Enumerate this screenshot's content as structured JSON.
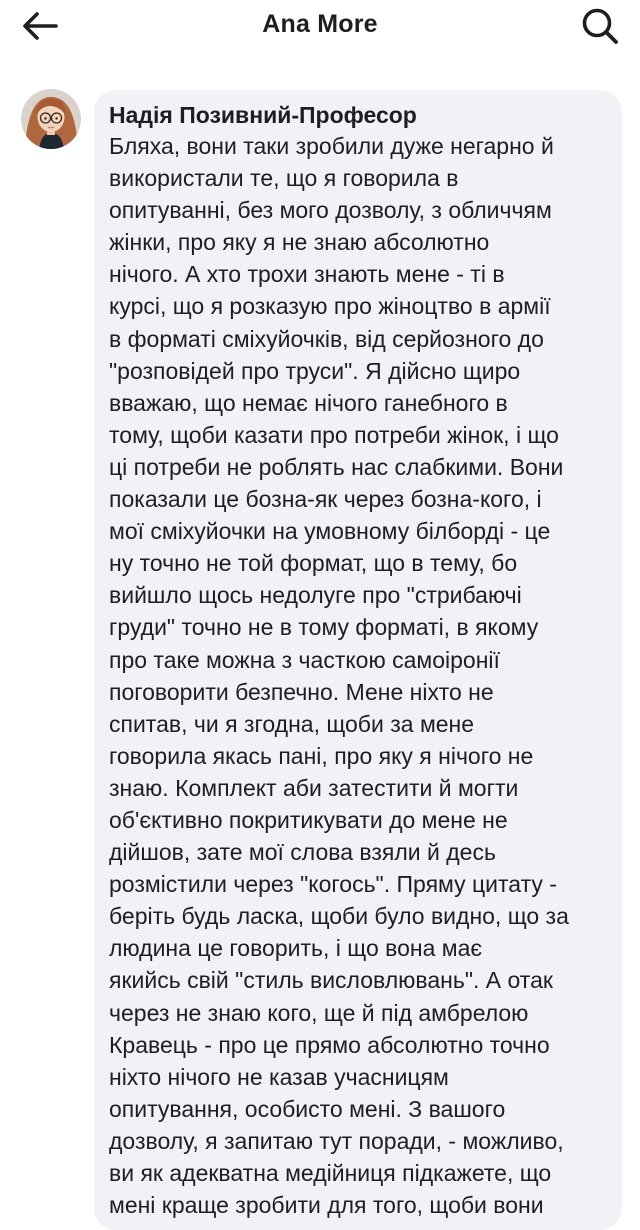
{
  "header": {
    "title": "Ana More",
    "back_icon": "arrow-left-icon",
    "search_icon": "search-icon"
  },
  "comment": {
    "author": "Надія Позивний-Професор",
    "avatar": "avatar-woman-glasses",
    "text": "Бляха, вони таки зробили дуже негарно й\nвикористали те, що я говорила в\nопитуванні, без мого дозволу, з обличчям\nжінки, про яку я не знаю абсолютно\nнічого. А хто трохи знають мене - ті в\nкурсі, що я розказую про жіноцтво в армії\nв форматі сміхуйочків, від серйозного до\n\"розповідей про труси\". Я дійсно щиро\nвважаю, що немає нічого ганебного в\nтому, щоби казати про потреби жінок, і що\nці потреби не роблять нас слабкими. Вони\nпоказали це бозна-як через бозна-кого, і\nмої сміхуйочки на умовному білборді - це\nну точно не той формат, що в тему, бо\nвийшло щось недолуге про \"стрибаючі\nгруди\" точно не в тому форматі, в якому\nпро таке можна з часткою самоіронії\nпоговорити безпечно. Мене ніхто не\nспитав, чи я згодна, щоби за мене\nговорила якась пані, про яку я нічого не\nзнаю. Комплект аби затестити й могти\nоб'єктивно покритикувати до мене не\nдійшов, зате мої слова взяли й десь\nрозмістили через \"когось\". Пряму цитату -\nберіть будь ласка, щоби було видно, що за\nлюдина це говорить, і що вона має\nякийсь свій \"стиль висловлювань\". А отак\nчерез не знаю кого, ще й під амбрелою\nКравець - про це прямо абсолютно точно\nніхто нічого не казав учасницям\nопитування, особисто мені. З вашого\nдозволу, я запитаю тут поради, - можливо,\nви як адекватна медійниця підкажете, що\nмені краще зробити для того, щоби вони"
  },
  "colors": {
    "bubble": "#f0f2f5",
    "text": "#1c1e21",
    "background": "#ffffff"
  }
}
